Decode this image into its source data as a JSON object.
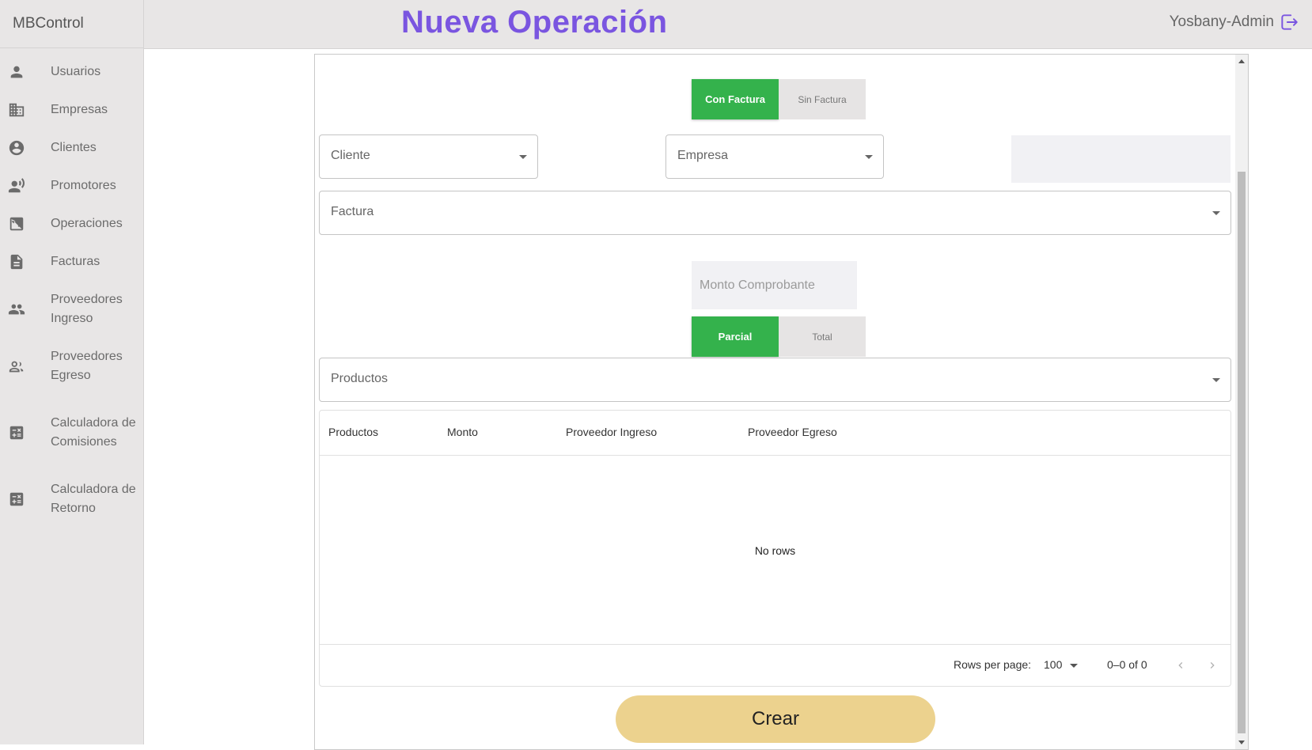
{
  "app": {
    "brand": "MBControl",
    "page_title": "Nueva Operación",
    "user_name": "Yosbany-Admin"
  },
  "sidebar": {
    "items": [
      {
        "label": "Usuarios",
        "icon": "person-icon"
      },
      {
        "label": "Empresas",
        "icon": "building-icon"
      },
      {
        "label": "Clientes",
        "icon": "account-circle-icon"
      },
      {
        "label": "Promotores",
        "icon": "record-voice-icon"
      },
      {
        "label": "Operaciones",
        "icon": "exposure-icon"
      },
      {
        "label": "Facturas",
        "icon": "document-icon"
      },
      {
        "label": "Proveedores Ingreso",
        "icon": "group-icon"
      },
      {
        "label": "Proveedores Egreso",
        "icon": "group-outline-icon"
      },
      {
        "label": "Calculadora de Comisiones",
        "icon": "calculator-icon"
      },
      {
        "label": "Calculadora de Retorno",
        "icon": "calculator-icon"
      }
    ]
  },
  "form": {
    "factura_toggle": {
      "options": [
        "Con Factura",
        "Sin Factura"
      ],
      "selected": "Con Factura"
    },
    "cliente_select": "Cliente",
    "empresa_select": "Empresa",
    "factura_select": "Factura",
    "monto_placeholder": "Monto Comprobante",
    "tipo_toggle": {
      "options": [
        "Parcial",
        "Total"
      ],
      "selected": "Parcial"
    },
    "productos_select": "Productos"
  },
  "table": {
    "columns": [
      "Productos",
      "Monto",
      "Proveedor Ingreso",
      "Proveedor Egreso"
    ],
    "empty_text": "No rows",
    "rows_per_page_label": "Rows per page:",
    "rows_per_page_value": "100",
    "pagination_range": "0–0 of 0"
  },
  "actions": {
    "create_label": "Crear"
  },
  "colors": {
    "accent_green": "#34b24c",
    "title_purple": "#7a55e0",
    "create_button": "#ecd28e"
  }
}
